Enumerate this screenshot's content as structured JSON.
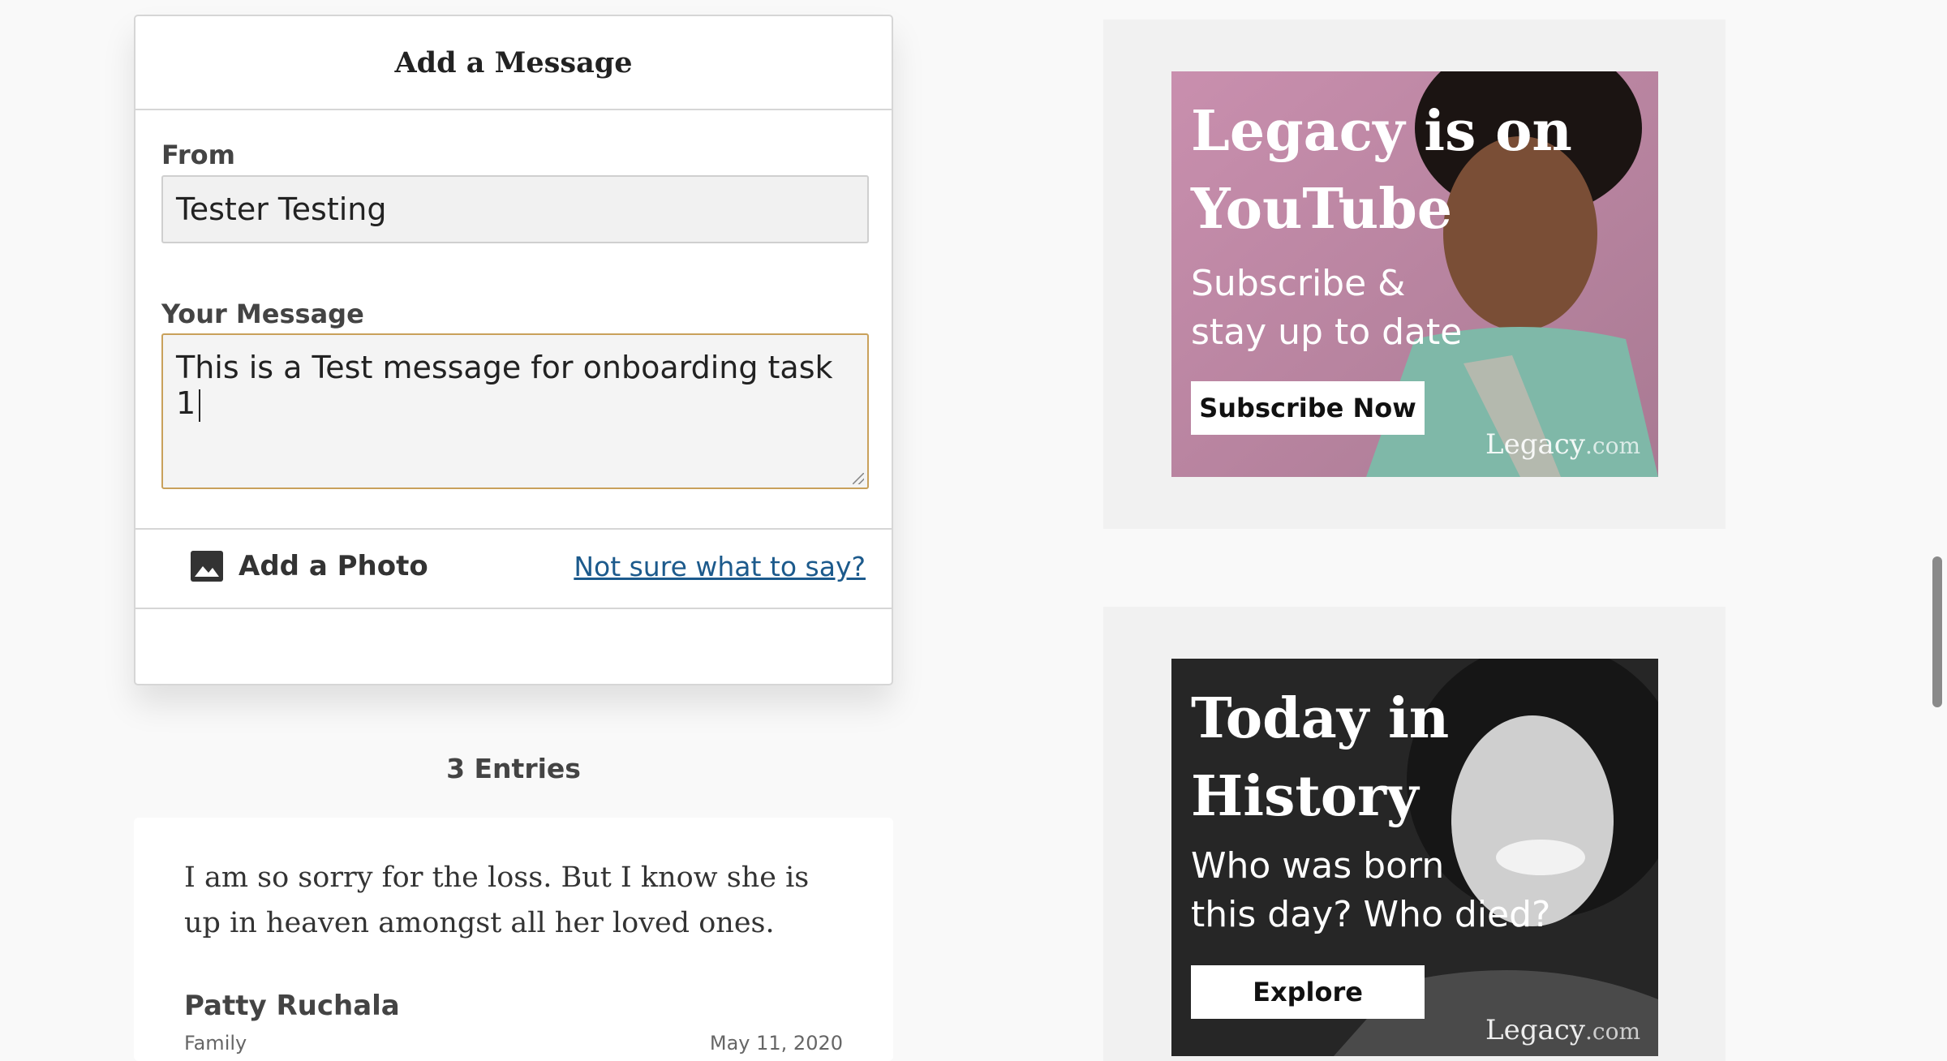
{
  "form": {
    "title": "Add a Message",
    "from_label": "From",
    "from_value": "Tester Testing",
    "message_label": "Your Message",
    "message_value": "This is a Test message for onboarding task 1",
    "add_photo_label": "Add a Photo",
    "help_link": "Not sure what to say?"
  },
  "entries": {
    "count_label": "3 Entries",
    "items": [
      {
        "text": "I am so sorry for the loss. But I know she is up in heaven amongst all her loved ones.",
        "author": "Patty Ruchala",
        "relation": "Family",
        "date": "May 11, 2020"
      }
    ]
  },
  "ads": [
    {
      "headline_line1": "Legacy is on",
      "headline_line2": "YouTube",
      "sub_line1": "Subscribe &",
      "sub_line2": "stay up to date",
      "button": "Subscribe Now",
      "logo": "Legacy",
      "logo_domain": ".com",
      "bg_color": "#c48aa8"
    },
    {
      "headline_line1": "Today in",
      "headline_line2": "History",
      "sub_line1": "Who was born",
      "sub_line2": "this day? Who died?",
      "button": "Explore",
      "logo": "Legacy",
      "logo_domain": ".com",
      "bg_color": "#2b2b2b"
    }
  ]
}
